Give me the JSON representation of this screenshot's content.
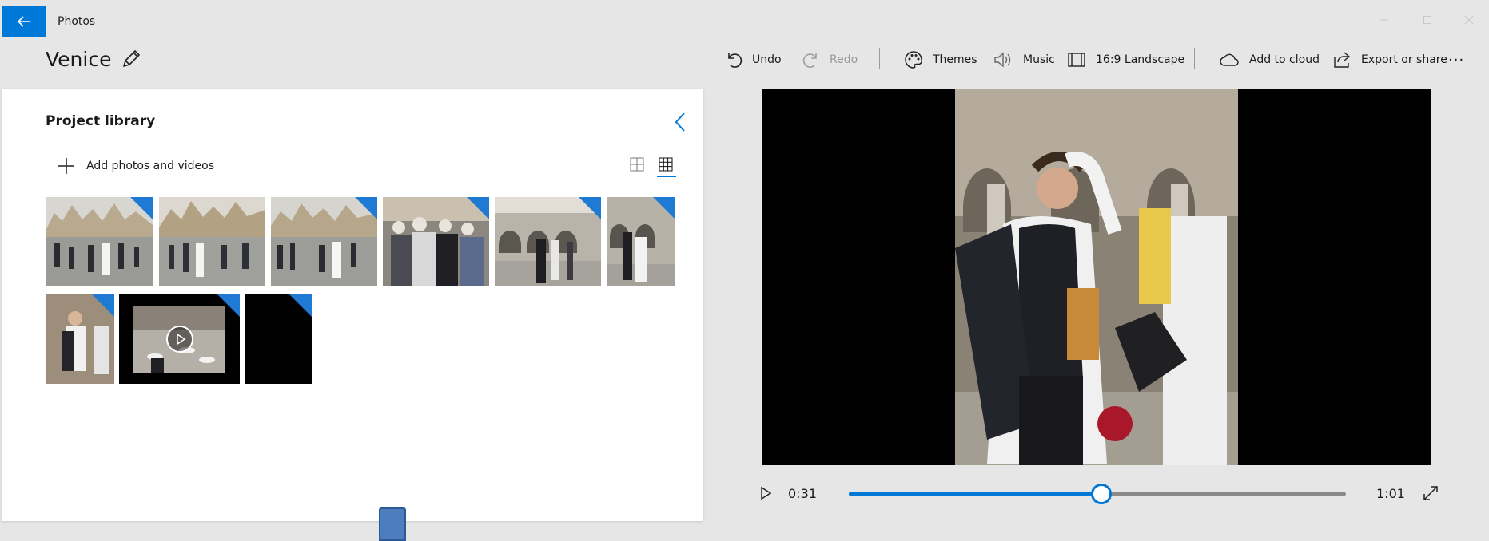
{
  "app": {
    "title": "Photos"
  },
  "project": {
    "name": "Venice"
  },
  "toolbar": {
    "undo": "Undo",
    "redo": "Redo",
    "themes": "Themes",
    "music": "Music",
    "aspect": "16:9 Landscape",
    "cloud": "Add to cloud",
    "export": "Export or share",
    "more": "···"
  },
  "library": {
    "title": "Project library",
    "add_label": "Add photos and videos",
    "view_mode": "small-thumbnails",
    "items": [
      {
        "type": "photo",
        "scene": "piazza"
      },
      {
        "type": "photo",
        "scene": "piazza"
      },
      {
        "type": "photo",
        "scene": "piazza"
      },
      {
        "type": "photo",
        "scene": "crowd"
      },
      {
        "type": "photo",
        "scene": "arcade"
      },
      {
        "type": "photo",
        "scene": "arcade"
      },
      {
        "type": "photo",
        "scene": "portrait"
      },
      {
        "type": "video",
        "scene": "cafe"
      },
      {
        "type": "blank",
        "scene": "black"
      }
    ]
  },
  "player": {
    "current_time": "0:31",
    "total_time": "1:01",
    "progress": 0.508
  },
  "colors": {
    "accent": "#0078d7",
    "corner_badge": "#1f7ad3"
  }
}
